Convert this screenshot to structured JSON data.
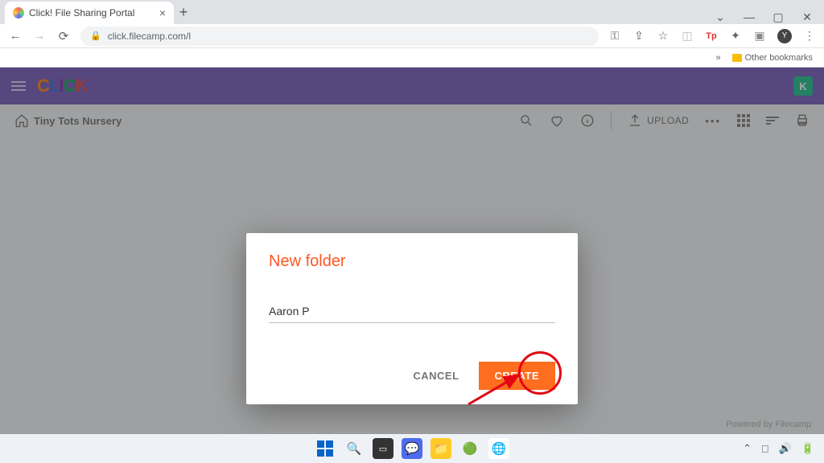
{
  "browser": {
    "tab_title": "Click! File Sharing Portal",
    "url": "click.filecamp.com/l",
    "other_bookmarks": "Other bookmarks",
    "avatar_letter": "Y",
    "tp_icon": "Tp"
  },
  "app": {
    "user_initial": "K",
    "breadcrumb": "Tiny Tots Nursery",
    "upload_label": "UPLOAD",
    "footer": "Powered by Filecamp"
  },
  "modal": {
    "title": "New folder",
    "input_value": "Aaron P",
    "cancel": "CANCEL",
    "create": "CREATE"
  }
}
